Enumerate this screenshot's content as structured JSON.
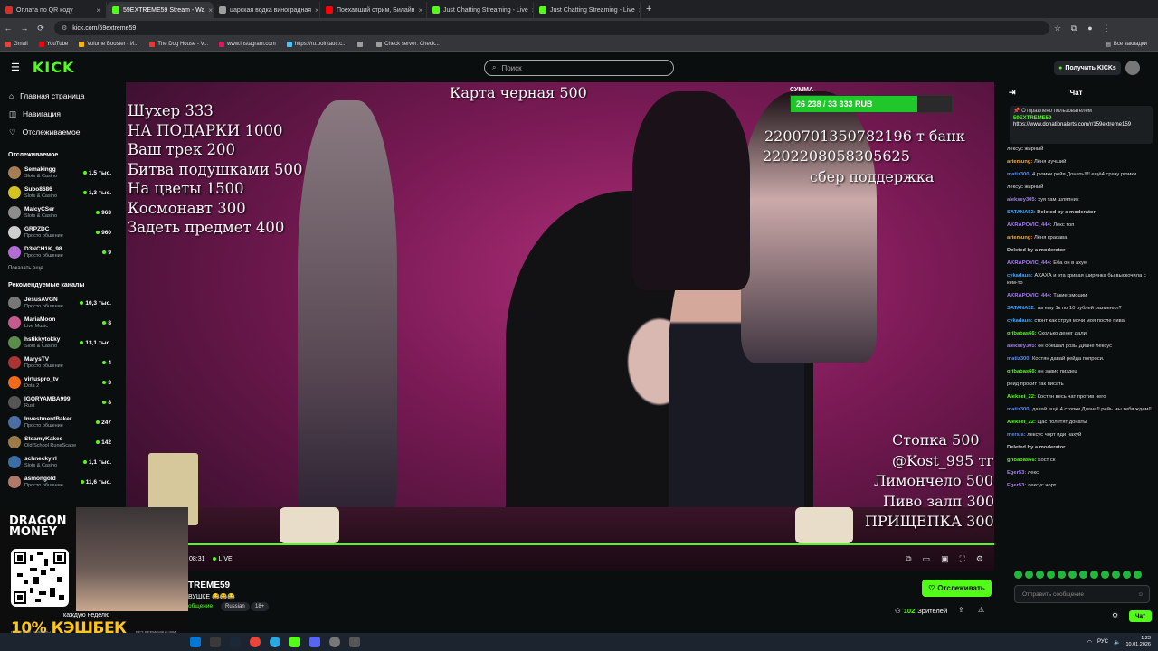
{
  "browser": {
    "tabs": [
      {
        "title": "Оплата по QR коду",
        "color": "#d32f2f",
        "active": false
      },
      {
        "title": "59EXTREME59 Stream - Wa",
        "color": "#53fc18",
        "active": true
      },
      {
        "title": "царская водка виноградная",
        "color": "#9e9e9e",
        "active": false
      },
      {
        "title": "Поехавший стрим, Билайн",
        "color": "#ff0000",
        "active": false
      },
      {
        "title": "Just Chatting Streaming - Live",
        "color": "#53fc18",
        "active": false
      },
      {
        "title": "Just Chatting Streaming - Live",
        "color": "#53fc18",
        "active": false
      }
    ],
    "new_tab": "+",
    "url": "kick.com/59extreme59",
    "bookmarks": [
      {
        "label": "Gmail",
        "color": "#ea4335"
      },
      {
        "label": "YouTube",
        "color": "#ff0000"
      },
      {
        "label": "Volume Booster - И...",
        "color": "#ffb300"
      },
      {
        "label": "The Dog House - V...",
        "color": "#e53935"
      },
      {
        "label": "www.instagram.com",
        "color": "#d81b60"
      },
      {
        "label": "https://ru.pointauc.c...",
        "color": "#4fc3f7"
      },
      {
        "label": "",
        "color": "#9e9e9e"
      },
      {
        "label": "Check server: Check...",
        "color": "#9e9e9e"
      }
    ],
    "all_bookmarks": "Все закладки"
  },
  "header": {
    "logo": "KICK",
    "search_placeholder": "Поиск",
    "get_kicks": "Получить KICKs"
  },
  "sidebar": {
    "nav": [
      {
        "label": "Главная страница",
        "icon": "home-icon",
        "glyph": "⌂"
      },
      {
        "label": "Навигация",
        "icon": "compass-icon",
        "glyph": "◫"
      },
      {
        "label": "Отслеживаемое",
        "icon": "heart-icon",
        "glyph": "♡"
      }
    ],
    "following_title": "Отслеживаемое",
    "following": [
      {
        "name": "Semakingg",
        "cat": "Slots & Casino",
        "viewers": "1,5 тыс.",
        "color": "#a67c52"
      },
      {
        "name": "Subo8686",
        "cat": "Slots & Casino",
        "viewers": "1,3 тыс.",
        "color": "#d4c21f"
      },
      {
        "name": "MalcyCSer",
        "cat": "Slots & Casino",
        "viewers": "963",
        "color": "#8d8d8d"
      },
      {
        "name": "GRPZDC",
        "cat": "Просто общение",
        "viewers": "960",
        "color": "#cfcfcf"
      },
      {
        "name": "D3NCH1K_98",
        "cat": "Просто общение",
        "viewers": "9",
        "color": "#b36bd6"
      }
    ],
    "show_more": "Показать еще",
    "recommended_title": "Рекомендуемые каналы",
    "recommended": [
      {
        "name": "JesusAVGN",
        "cat": "Просто общение",
        "viewers": "10,3 тыс.",
        "color": "#777"
      },
      {
        "name": "MariaMoon",
        "cat": "Live Music",
        "viewers": "8",
        "color": "#c75a8c"
      },
      {
        "name": "hstikkytokky",
        "cat": "Slots & Casino",
        "viewers": "13,1 тыс.",
        "color": "#5a8c4a"
      },
      {
        "name": "MarysTV",
        "cat": "Просто общение",
        "viewers": "4",
        "color": "#a33"
      },
      {
        "name": "virtuspro_tv",
        "cat": "Dota 2",
        "viewers": "3",
        "color": "#f26b1d"
      },
      {
        "name": "IGORYAMBA999",
        "cat": "Rust",
        "viewers": "8",
        "color": "#555"
      },
      {
        "name": "InvestmentBaker",
        "cat": "Просто общение",
        "viewers": "247",
        "color": "#4a6fa5"
      },
      {
        "name": "SteamyKakes",
        "cat": "Old School RuneScape",
        "viewers": "142",
        "color": "#9c7b4a"
      },
      {
        "name": "schneckyirl",
        "cat": "Slots & Casino",
        "viewers": "1,1 тыс.",
        "color": "#3a6ea5"
      },
      {
        "name": "asmongold",
        "cat": "Просто общение",
        "viewers": "11,6 тыс.",
        "color": "#b07a6a"
      }
    ]
  },
  "video": {
    "left_list": [
      "Шухер 333",
      "НА ПОДАРКИ 1000",
      "Ваш трек 200",
      "Битва подушками 500",
      "На цветы 1500",
      "Космонавт 300",
      "Задеть предмет 400"
    ],
    "card": "Карта черная 500",
    "sum_label": "СУММА",
    "sum_text": "26 238 / 33 333 RUB",
    "sum_progress": 0.787,
    "bank_lines": [
      "2200701350782196 т банк",
      "2202208058305625",
      "сбер поддержка"
    ],
    "right_list": [
      "Стопка 500",
      "@Kost_995 тг",
      "Лимончело 500",
      "Пиво залп 300",
      "ПРИЩЕПКА 300"
    ],
    "time": "08:31",
    "live": "LIVE"
  },
  "stream": {
    "title": "TREME59",
    "subtitle": "ВУШКЕ 😂😂😂",
    "category": "общение",
    "tags": [
      "Russian",
      "18+"
    ],
    "follow": "Отслеживать",
    "viewers_count": "102",
    "viewers_label": "Зрителей"
  },
  "ad": {
    "brand_line1": "DRAGON",
    "brand_line2": "MONEY",
    "weekly": "каждую неделю",
    "cashback": "10% КЭШБЕК",
    "fast": "БЫСТРЫЕ ВЫВОДЫ",
    "no_verify": "БЕЗ ВЕРИФИКАЦИИ"
  },
  "chat": {
    "title": "Чат",
    "pinned_by": "Отправлено пользователем",
    "pinned_user": "59EXTREME59",
    "pinned_link": "https://www.donationalerts.com/r/159extreme159",
    "messages": [
      {
        "u": "",
        "c": "#e33",
        "t": "лексус жирный"
      },
      {
        "u": "artemung:",
        "c": "#f5a623",
        "t": "Лёня лучший"
      },
      {
        "u": "matiz300:",
        "c": "#5b8def",
        "t": "4 рюмки рейя Донать!!!! ещё4 сразу рюмки"
      },
      {
        "u": "",
        "c": "#e33",
        "t": "лексус жирный"
      },
      {
        "u": "aleksey305:",
        "c": "#a57de8",
        "t": "хуя там шляпник"
      },
      {
        "u": "SATANA52:",
        "c": "#3ea6ff",
        "t": "Deleted by a moderator",
        "mod": true
      },
      {
        "u": "AKRAPOVIC_444:",
        "c": "#a57de8",
        "t": "Лекс топ"
      },
      {
        "u": "artemung:",
        "c": "#f5a623",
        "t": "Лёня красава"
      },
      {
        "u": "",
        "c": "#e33",
        "t": "Deleted by a moderator",
        "mod": true
      },
      {
        "u": "AKRAPOVIC_444:",
        "c": "#a57de8",
        "t": "Еба он в ахуе"
      },
      {
        "u": "cykadaun:",
        "c": "#3ea6ff",
        "t": "АХАХА и эта кривая ширинка бы выскочила с кем-то"
      },
      {
        "u": "AKRAPOVIC_444:",
        "c": "#a57de8",
        "t": "Такие эмоции"
      },
      {
        "u": "SATANA52:",
        "c": "#3ea6ff",
        "t": "ты ему 1к по 10 рублей разменял?"
      },
      {
        "u": "cykadaun:",
        "c": "#3ea6ff",
        "t": "стонт как струя мочи моя после пива"
      },
      {
        "u": "gribabas66:",
        "c": "#53fc18",
        "t": "Сколько денег дали"
      },
      {
        "u": "aleksey305:",
        "c": "#a57de8",
        "t": "он обещал розы Диане лексус"
      },
      {
        "u": "matiz300:",
        "c": "#5b8def",
        "t": "Костян давай рейда попроси."
      },
      {
        "u": "gribabas66:",
        "c": "#53fc18",
        "t": "он завис пиздец"
      },
      {
        "u": "",
        "c": "#e33",
        "t": "рейд просит так писать"
      },
      {
        "u": "Aleksei_22:",
        "c": "#53fc18",
        "t": "Костян весь чат против него"
      },
      {
        "u": "matiz300:",
        "c": "#5b8def",
        "t": "давай ещё 4 стопки Диане!! рейь мы тебя ждем!!"
      },
      {
        "u": "Aleksei_22:",
        "c": "#53fc18",
        "t": "щас полетят донаты"
      },
      {
        "u": "mersis:",
        "c": "#5b8def",
        "t": "лексус чорт иди нахуй"
      },
      {
        "u": "",
        "c": "#e33",
        "t": "Deleted by a moderator",
        "mod": true
      },
      {
        "u": "gribabas66:",
        "c": "#53fc18",
        "t": "Кост ск"
      },
      {
        "u": "Eger53:",
        "c": "#a57de8",
        "t": "лекс"
      },
      {
        "u": "Eger53:",
        "c": "#a57de8",
        "t": "лексус чорт"
      }
    ],
    "input_placeholder": "Отправить сообщение",
    "send": "Чат"
  },
  "taskbar": {
    "lang": "РУС",
    "time": "1:23",
    "date": "10.01.2026"
  }
}
